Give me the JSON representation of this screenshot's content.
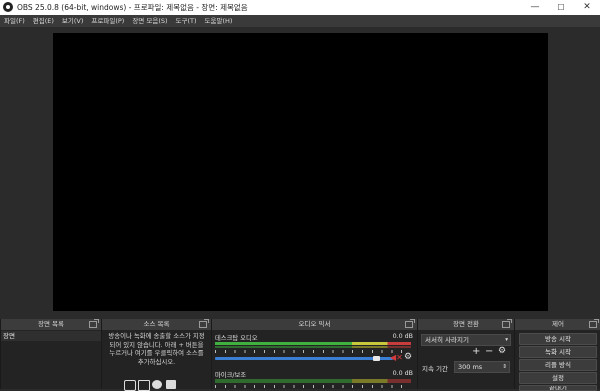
{
  "window": {
    "title": "OBS 25.0.8 (64-bit, windows) - 프로파일: 제목없음 - 장면: 제목없음",
    "minimize": "—",
    "maximize": "☐",
    "close": "✕"
  },
  "menu": [
    "파일(F)",
    "편집(E)",
    "보기(V)",
    "프로파일(P)",
    "장면 모음(S)",
    "도구(T)",
    "도움말(H)"
  ],
  "docks": {
    "scenes": {
      "title": "장면 목록",
      "items": [
        "장면"
      ]
    },
    "sources": {
      "title": "소스 목록",
      "hint": "방송이나 녹화에 송출할 소스가 지정되어 있지 않습니다. 아래 + 버튼을 누르거나 여기를 우클릭하여 소스를 추가하십시오."
    },
    "mixer": {
      "title": "오디오 믹서",
      "channels": [
        {
          "label": "데스크탑 오디오",
          "db": "0.0 dB"
        },
        {
          "label": "마이크/보조",
          "db": "0.0 dB"
        }
      ]
    },
    "transitions": {
      "title": "장면 전환",
      "type": "서서히 사라지기",
      "duration_label": "지속 기간",
      "duration_value": "300 ms"
    },
    "controls": {
      "title": "제어",
      "buttons": [
        "방송 시작",
        "녹화 시작",
        "리플 방식",
        "설정",
        "끝내기"
      ]
    }
  },
  "icons": {
    "add": "+",
    "remove": "−",
    "gear": "⚙",
    "speaker_muted": "🔇"
  }
}
